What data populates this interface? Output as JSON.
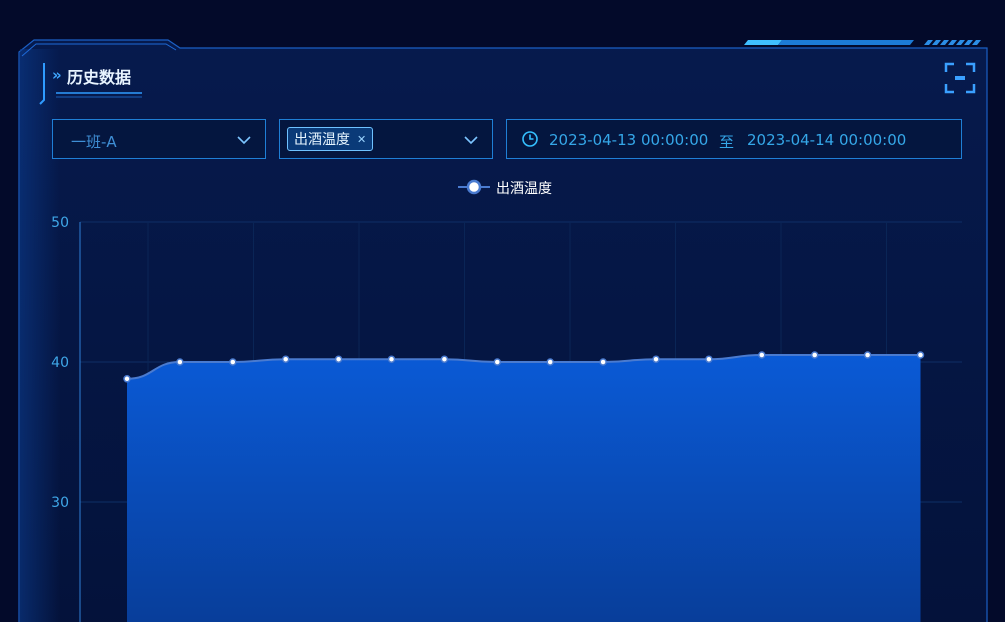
{
  "panel": {
    "title": "历史数据"
  },
  "filters": {
    "team": {
      "value": "一班-A"
    },
    "metric_tags": [
      {
        "label": "出酒温度"
      }
    ],
    "date_range": {
      "start": "2023-04-13 00:00:00",
      "separator": "至",
      "end": "2023-04-14 00:00:00"
    }
  },
  "colors": {
    "accent": "#1f7fd6",
    "series_line": "#4a7bd0",
    "area_top": "#0a5ad6",
    "background": "#030a2a"
  },
  "icons": {
    "fullscreen": "fullscreen-icon",
    "clock": "clock-icon",
    "chevron": "chevron-down-icon",
    "close": "close-icon"
  },
  "chart_data": {
    "type": "area",
    "title": "",
    "xlabel": "",
    "ylabel": "",
    "ylim": [
      0,
      50
    ],
    "y_ticks": [
      30,
      40,
      50
    ],
    "legend_position": "top-center",
    "grid": true,
    "series": [
      {
        "name": "出酒温度",
        "values": [
          38.8,
          40.0,
          40.0,
          40.2,
          40.2,
          40.2,
          40.2,
          40.0,
          40.0,
          40.0,
          40.2,
          40.2,
          40.5,
          40.5,
          40.5,
          40.5
        ]
      }
    ]
  }
}
